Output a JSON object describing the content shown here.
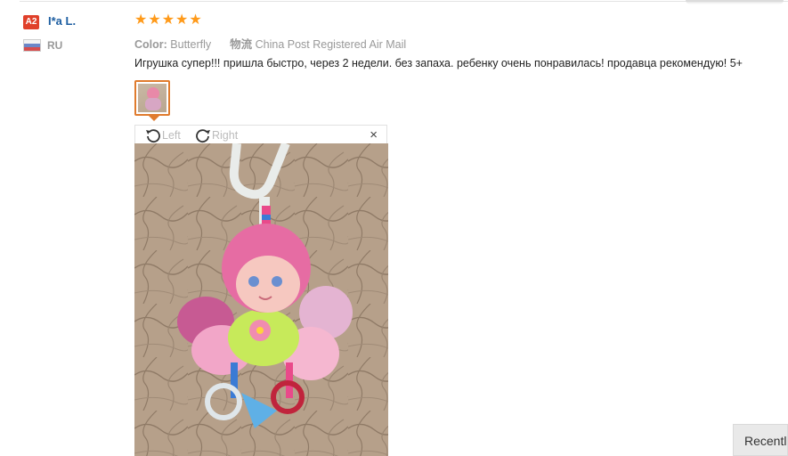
{
  "reviewer": {
    "level": "A2",
    "name": "I*a L.",
    "country": "RU",
    "flag_colors": [
      "#f3f3f3",
      "#6b86c7",
      "#d64c4c"
    ]
  },
  "review": {
    "rating": 5,
    "star_color": "#ff9a1a",
    "color_label": "Color:",
    "color_value": "Butterfly",
    "shipping_label": "物流",
    "shipping_value": "China Post Registered Air Mail",
    "text": "Игрушка супер!!! пришла быстро, через 2 недели. без запаха. ребенку очень понравилась! продавца рекомендую! 5+"
  },
  "viewer": {
    "rotate_left_label": "Left",
    "rotate_right_label": "Right",
    "close_symbol": "×",
    "icons": [
      "rotate-left-icon",
      "rotate-right-icon",
      "close-icon"
    ]
  },
  "sidebar_tab": {
    "label": "Recentl"
  }
}
